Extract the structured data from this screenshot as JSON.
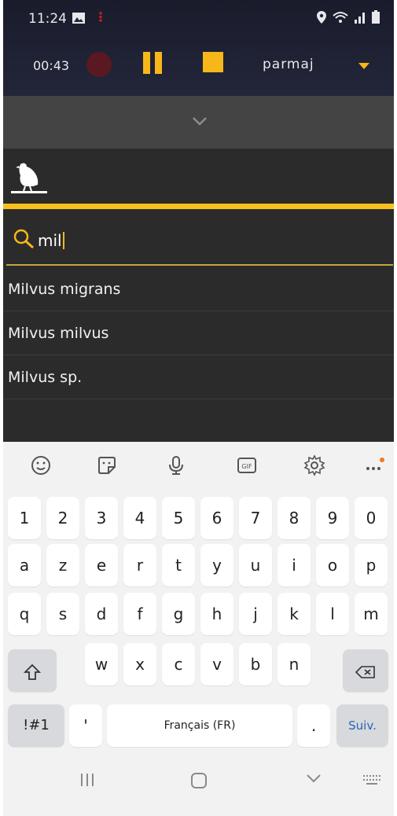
{
  "status": {
    "time": "11:24"
  },
  "recorder": {
    "elapsed": "00:43",
    "username": "parmaj"
  },
  "search": {
    "query": "mil"
  },
  "results": [
    "Milvus migrans",
    "Milvus milvus",
    "Milvus sp."
  ],
  "keyboard": {
    "row_numbers": [
      "1",
      "2",
      "3",
      "4",
      "5",
      "6",
      "7",
      "8",
      "9",
      "0"
    ],
    "row1": [
      "a",
      "z",
      "e",
      "r",
      "t",
      "y",
      "u",
      "i",
      "o",
      "p"
    ],
    "row2": [
      "q",
      "s",
      "d",
      "f",
      "g",
      "h",
      "j",
      "k",
      "l",
      "m"
    ],
    "row3": [
      "w",
      "x",
      "c",
      "v",
      "b",
      "n"
    ],
    "symbols_label": "!#1",
    "apostrophe": "'",
    "space_label": "Français (FR)",
    "period": ".",
    "action_label": "Suiv."
  },
  "colors": {
    "accent": "#f8b718",
    "header_bg": "#1a1c2c",
    "list_bg": "#2b2b2b"
  }
}
